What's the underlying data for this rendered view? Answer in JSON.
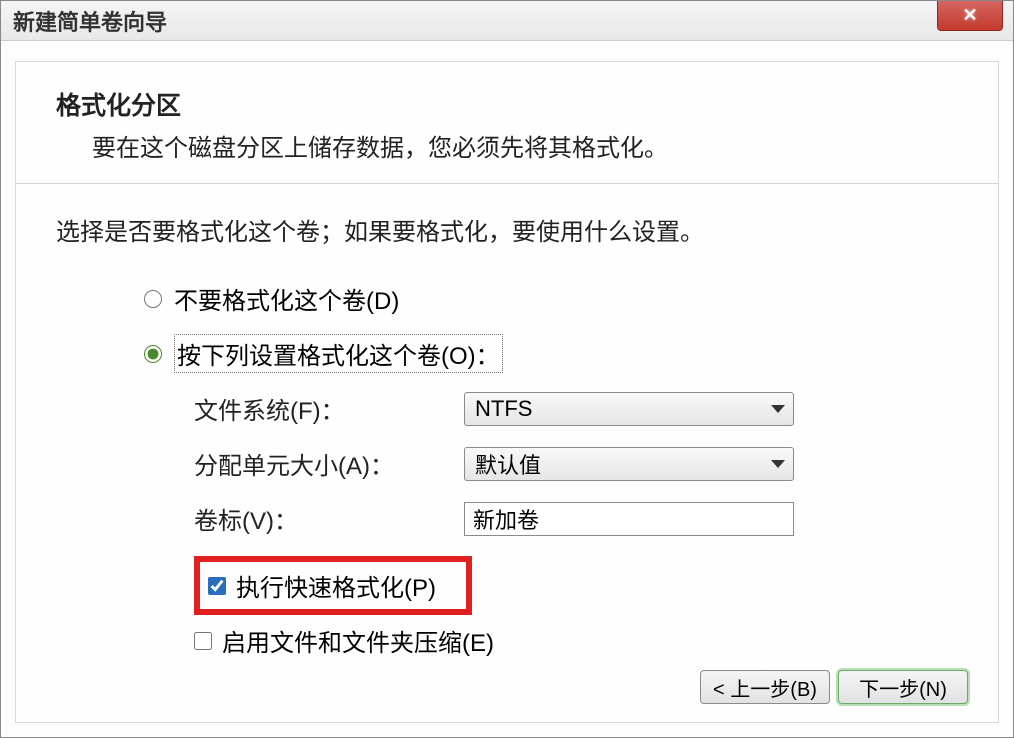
{
  "window": {
    "title": "新建简单卷向导"
  },
  "header": {
    "title": "格式化分区",
    "subtitle": "要在这个磁盘分区上储存数据，您必须先将其格式化。"
  },
  "body": {
    "instruction": "选择是否要格式化这个卷；如果要格式化，要使用什么设置。"
  },
  "radios": {
    "no_format": "不要格式化这个卷(D)",
    "do_format": "按下列设置格式化这个卷(O)："
  },
  "form": {
    "fs_label": "文件系统(F)：",
    "fs_value": "NTFS",
    "alloc_label": "分配单元大小(A)：",
    "alloc_value": "默认值",
    "volume_label": "卷标(V)：",
    "volume_value": "新加卷"
  },
  "checks": {
    "quick_format": "执行快速格式化(P)",
    "compression": "启用文件和文件夹压缩(E)"
  },
  "footer": {
    "back": "< 上一步(B)",
    "next": "下一步(N)"
  }
}
